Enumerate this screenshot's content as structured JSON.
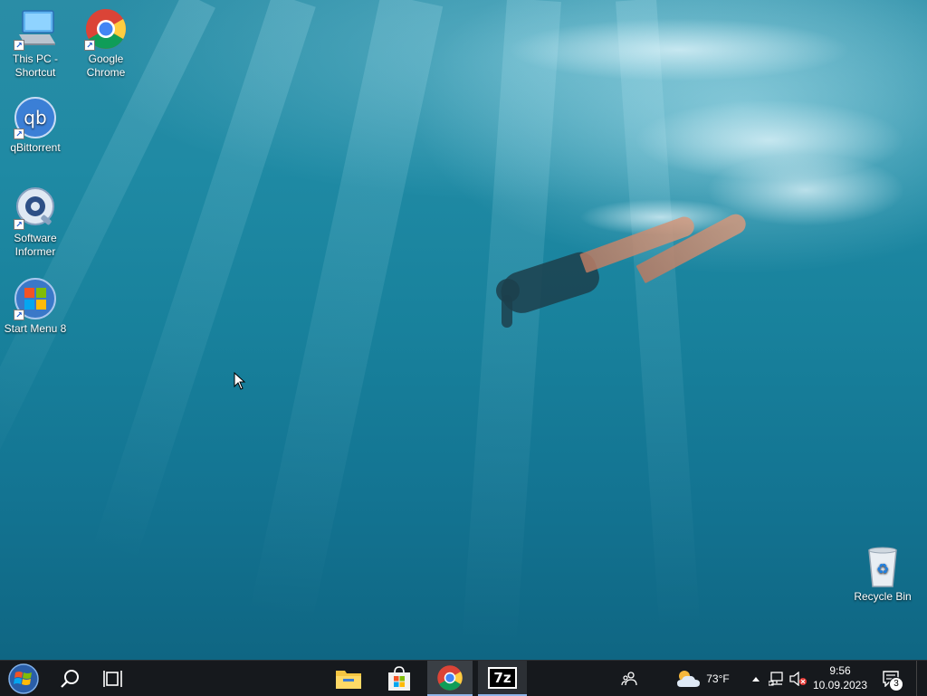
{
  "desktop": {
    "icons": [
      {
        "label": "This PC - Shortcut",
        "icon": "this-pc-icon"
      },
      {
        "label": "Google Chrome",
        "icon": "chrome-icon"
      },
      {
        "label": "qBittorrent",
        "icon": "qbittorrent-icon"
      },
      {
        "label": "Software Informer",
        "icon": "software-informer-icon"
      },
      {
        "label": "Start Menu 8",
        "icon": "start-menu-8-icon"
      },
      {
        "label": "Recycle Bin",
        "icon": "recycle-bin-icon"
      }
    ]
  },
  "taskbar": {
    "start": {
      "icon": "windows-start-icon"
    },
    "search": {
      "icon": "search-icon"
    },
    "task_view": {
      "icon": "task-view-icon"
    },
    "pinned": [
      {
        "name": "File Explorer",
        "icon": "file-explorer-icon",
        "state": "pinned"
      },
      {
        "name": "Microsoft Store",
        "icon": "store-icon",
        "state": "pinned"
      },
      {
        "name": "Google Chrome",
        "icon": "chrome-icon",
        "state": "active"
      },
      {
        "name": "7-Zip",
        "icon": "7zip-icon",
        "label": "7z",
        "state": "running"
      }
    ],
    "tray": {
      "people_icon": "people-icon",
      "weather": {
        "icon": "weather-partly-cloudy-icon",
        "temperature": "73°F"
      },
      "overflow_icon": "chevron-up-icon",
      "network_icon": "network-icon",
      "volume_icon": "volume-muted-icon",
      "time": "9:56",
      "date": "10.09.2023",
      "notifications": {
        "icon": "notification-icon",
        "count": "3"
      }
    }
  },
  "colors": {
    "taskbar_bg": "#16191d",
    "accent": "#8fb4e8",
    "water_top": "#2a8da6",
    "water_bottom": "#0f6683"
  }
}
